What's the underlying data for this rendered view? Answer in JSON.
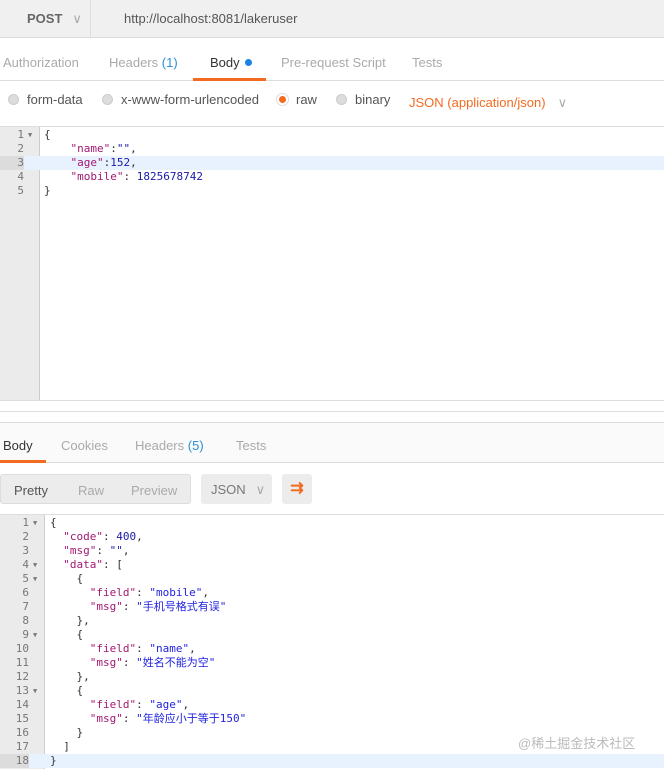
{
  "request": {
    "method": "POST",
    "url": "http://localhost:8081/lakeruser"
  },
  "req_tabs": [
    {
      "label": "Authorization"
    },
    {
      "label": "Headers",
      "count": "(1)"
    },
    {
      "label": "Body"
    },
    {
      "label": "Pre-request Script"
    },
    {
      "label": "Tests"
    }
  ],
  "body_modes": [
    "form-data",
    "x-www-form-urlencoded",
    "raw",
    "binary"
  ],
  "selected_mode": "raw",
  "content_type": "JSON (application/json)",
  "req_code": [
    [
      [
        "p",
        "{"
      ]
    ],
    [
      [
        "p",
        "    "
      ],
      [
        "k",
        "\"name\""
      ],
      [
        "p",
        ":"
      ],
      [
        "s",
        "\"\""
      ],
      [
        "p",
        ","
      ]
    ],
    [
      [
        "p",
        "    "
      ],
      [
        "k",
        "\"age\""
      ],
      [
        "p",
        ":"
      ],
      [
        "n",
        "152"
      ],
      [
        "p",
        ","
      ]
    ],
    [
      [
        "p",
        "    "
      ],
      [
        "k",
        "\"mobile\""
      ],
      [
        "p",
        ": "
      ],
      [
        "n",
        "1825678742"
      ]
    ],
    [
      [
        "p",
        "}"
      ]
    ]
  ],
  "resp_tabs": [
    {
      "label": "Body"
    },
    {
      "label": "Cookies"
    },
    {
      "label": "Headers",
      "count": "(5)"
    },
    {
      "label": "Tests"
    }
  ],
  "view_modes": [
    "Pretty",
    "Raw",
    "Preview"
  ],
  "format": "JSON",
  "resp_code": [
    [
      [
        "p",
        "{"
      ]
    ],
    [
      [
        "p",
        "  "
      ],
      [
        "k",
        "\"code\""
      ],
      [
        "p",
        ": "
      ],
      [
        "n",
        "400"
      ],
      [
        "p",
        ","
      ]
    ],
    [
      [
        "p",
        "  "
      ],
      [
        "k",
        "\"msg\""
      ],
      [
        "p",
        ": "
      ],
      [
        "s",
        "\"\""
      ],
      [
        "p",
        ","
      ]
    ],
    [
      [
        "p",
        "  "
      ],
      [
        "k",
        "\"data\""
      ],
      [
        "p",
        ": ["
      ]
    ],
    [
      [
        "p",
        "    {"
      ]
    ],
    [
      [
        "p",
        "      "
      ],
      [
        "k",
        "\"field\""
      ],
      [
        "p",
        ": "
      ],
      [
        "sv",
        "\"mobile\""
      ],
      [
        "p",
        ","
      ]
    ],
    [
      [
        "p",
        "      "
      ],
      [
        "k",
        "\"msg\""
      ],
      [
        "p",
        ": "
      ],
      [
        "sv",
        "\"手机号格式有误\""
      ]
    ],
    [
      [
        "p",
        "    },"
      ]
    ],
    [
      [
        "p",
        "    {"
      ]
    ],
    [
      [
        "p",
        "      "
      ],
      [
        "k",
        "\"field\""
      ],
      [
        "p",
        ": "
      ],
      [
        "sv",
        "\"name\""
      ],
      [
        "p",
        ","
      ]
    ],
    [
      [
        "p",
        "      "
      ],
      [
        "k",
        "\"msg\""
      ],
      [
        "p",
        ": "
      ],
      [
        "sv",
        "\"姓名不能为空\""
      ]
    ],
    [
      [
        "p",
        "    },"
      ]
    ],
    [
      [
        "p",
        "    {"
      ]
    ],
    [
      [
        "p",
        "      "
      ],
      [
        "k",
        "\"field\""
      ],
      [
        "p",
        ": "
      ],
      [
        "sv",
        "\"age\""
      ],
      [
        "p",
        ","
      ]
    ],
    [
      [
        "p",
        "      "
      ],
      [
        "k",
        "\"msg\""
      ],
      [
        "p",
        ": "
      ],
      [
        "sv",
        "\"年龄应小于等于150\""
      ]
    ],
    [
      [
        "p",
        "    }"
      ]
    ],
    [
      [
        "p",
        "  ]"
      ]
    ],
    [
      [
        "p",
        "}"
      ]
    ]
  ],
  "watermark": "@稀土掘金技术社区"
}
